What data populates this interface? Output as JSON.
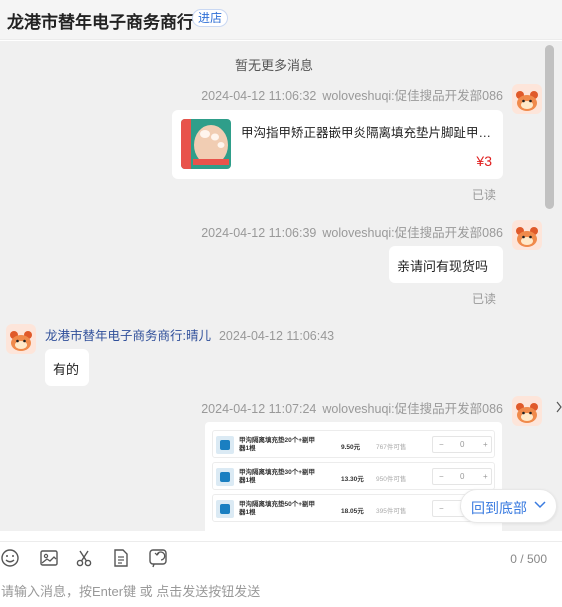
{
  "header": {
    "shop_name": "龙港市替年电子商务商行",
    "enter_shop": "进店"
  },
  "chat": {
    "no_more": "暂无更多消息",
    "messages": [
      {
        "time": "2024-04-12 11:06:32",
        "sender": "woloveshuqi:促佳搜品开发部086",
        "type": "product",
        "product_title": "甲沟指甲矫正器嵌甲炎隔离填充垫片脚趾甲往...",
        "price": "¥3",
        "status": "已读"
      },
      {
        "time": "2024-04-12 11:06:39",
        "sender": "woloveshuqi:促佳搜品开发部086",
        "text": "亲请问有现货吗",
        "status": "已读"
      },
      {
        "time": "2024-04-12 11:06:43",
        "sender": "龙港市替年电子商务商行:晴儿",
        "text": "有的"
      },
      {
        "time": "2024-04-12 11:07:24",
        "sender": "woloveshuqi:促佳搜品开发部086",
        "type": "sku-card",
        "skus": [
          {
            "name": "甲沟隔离填充垫20个+剔甲器1根",
            "price": "9.50元",
            "stock": "767件可售",
            "qty": "0",
            "minus": "−",
            "plus": "+"
          },
          {
            "name": "甲沟隔离填充垫30个+剔甲器1根",
            "price": "13.30元",
            "stock": "950件可售",
            "qty": "0",
            "minus": "−",
            "plus": "+"
          },
          {
            "name": "甲沟隔离填充垫50个+剔甲器1根",
            "price": "18.05元",
            "stock": "395件可售",
            "qty": "0",
            "minus": "−",
            "plus": "+"
          }
        ]
      }
    ]
  },
  "scroll_to_bottom": "回到底部",
  "toolbar": {
    "icons": [
      "emoji-icon",
      "image-icon",
      "scissors-icon",
      "document-icon",
      "recall-icon"
    ],
    "counter": "0 / 500"
  },
  "input": {
    "placeholder": "请输入消息，按Enter键 或 点击发送按钮发送"
  },
  "colors": {
    "accent": "#3a7be0",
    "price": "#e02020",
    "chat_bg": "#f0f0f0"
  }
}
